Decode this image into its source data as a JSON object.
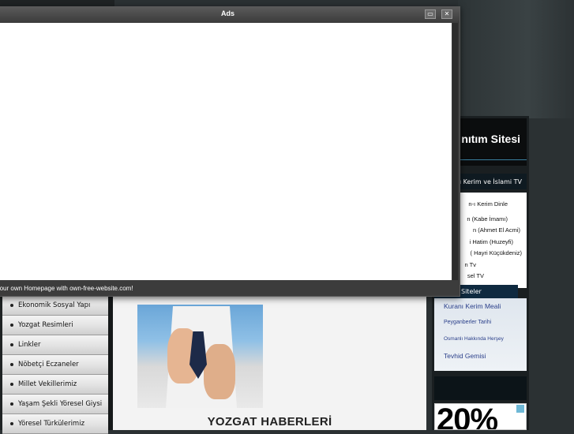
{
  "popup": {
    "title": "Ads",
    "footer_text": "Your own Homepage with own-free-website.com!",
    "restore_label": "▭",
    "close_label": "✕"
  },
  "nav": {
    "items": [
      "Ekonomik Sosyal Yapı",
      "Yozgat Resimleri",
      "Linkler",
      "Nöbetçi Eczaneler",
      "Millet Vekillerimiz",
      "Yaşam Şekli Yöresel Giysi",
      "Yöresel Türkülerimiz"
    ]
  },
  "content": {
    "headline": "YOZGAT HABERLERİ"
  },
  "sidebar": {
    "banner_title": "nıtım Sitesi",
    "section_title": "ı Kerim ve İslami TV",
    "list": [
      "n-ı Kerim Dinle",
      "n (Kabe İmamı)",
      "n (Ahmet El Acmi)",
      "i Hatim (Huzeyfi)",
      "( Hayri Küçükdeniz)",
      "n Tv",
      "sel TV"
    ],
    "links_title": "Siteler",
    "links": [
      "Kuranı Kerim Meali",
      "Peyganberler Tarihi",
      "Osmanlı Hakkında Herşey",
      "Tevhid Gemisi"
    ],
    "ad_text": "20%"
  },
  "colors": {
    "page_bg": "#2b3133",
    "popup_chrome": "#3c3c3c",
    "sidebar_link": "#2a3f8a",
    "banner_accent": "#3a7fa0"
  }
}
